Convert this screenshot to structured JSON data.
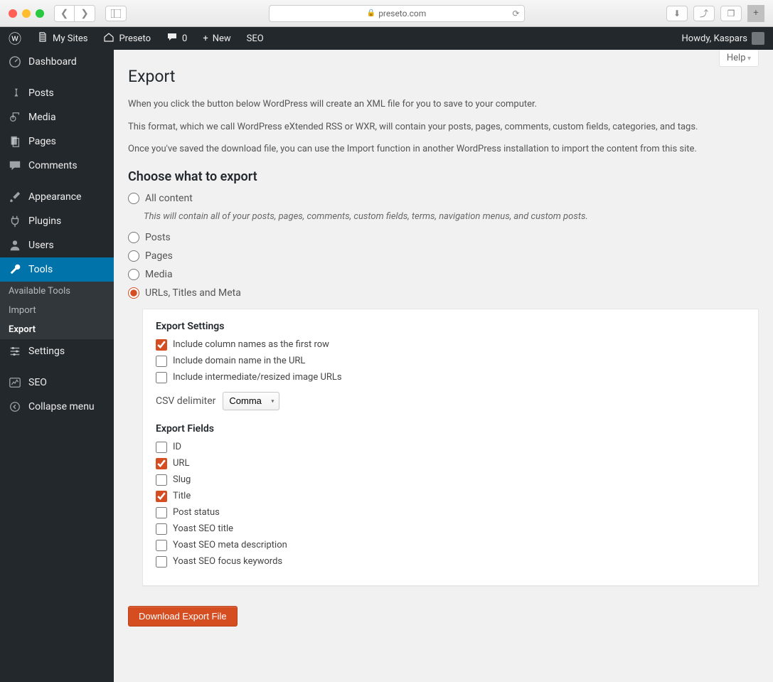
{
  "browser": {
    "url_host": "preseto.com"
  },
  "adminbar": {
    "my_sites": "My Sites",
    "site_name": "Preseto",
    "comments_count": "0",
    "new_label": "New",
    "seo_label": "SEO",
    "howdy": "Howdy, Kaspars"
  },
  "sidemenu": {
    "dashboard": "Dashboard",
    "posts": "Posts",
    "media": "Media",
    "pages": "Pages",
    "comments": "Comments",
    "appearance": "Appearance",
    "plugins": "Plugins",
    "users": "Users",
    "tools": "Tools",
    "settings": "Settings",
    "seo": "SEO",
    "collapse": "Collapse menu",
    "tools_sub": {
      "available": "Available Tools",
      "import": "Import",
      "export": "Export"
    }
  },
  "page": {
    "help_label": "Help",
    "title": "Export",
    "intro1": "When you click the button below WordPress will create an XML file for you to save to your computer.",
    "intro2": "This format, which we call WordPress eXtended RSS or WXR, will contain your posts, pages, comments, custom fields, categories, and tags.",
    "intro3": "Once you've saved the download file, you can use the Import function in another WordPress installation to import the content from this site.",
    "choose_title": "Choose what to export",
    "radio": {
      "all": "All content",
      "all_hint": "This will contain all of your posts, pages, comments, custom fields, terms, navigation menus, and custom posts.",
      "posts": "Posts",
      "pages": "Pages",
      "media": "Media",
      "urls_meta": "URLs, Titles and Meta"
    },
    "box": {
      "settings_title": "Export Settings",
      "include_columns": "Include column names as the first row",
      "include_domain": "Include domain name in the URL",
      "include_intermediate": "Include intermediate/resized image URLs",
      "csv_label": "CSV delimiter",
      "csv_value": "Comma",
      "fields_title": "Export Fields",
      "f_id": "ID",
      "f_url": "URL",
      "f_slug": "Slug",
      "f_title": "Title",
      "f_status": "Post status",
      "f_yoast_title": "Yoast SEO title",
      "f_yoast_desc": "Yoast SEO meta description",
      "f_yoast_kw": "Yoast SEO focus keywords"
    },
    "download_btn": "Download Export File"
  }
}
